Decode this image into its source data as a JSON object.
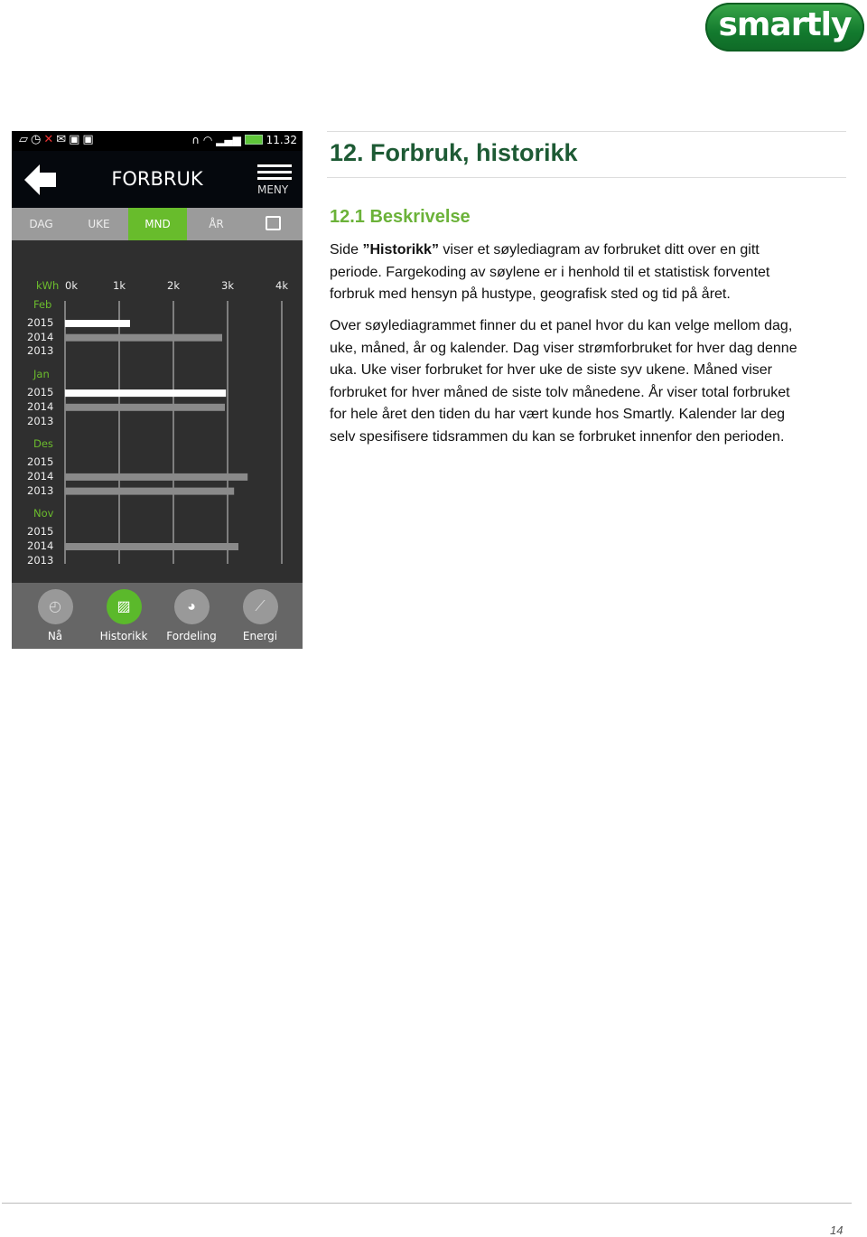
{
  "logo": {
    "text": "smartly"
  },
  "phone": {
    "status_bar": {
      "icons": [
        "screenshot-icon",
        "download-icon",
        "missed-call-icon",
        "mail-icon",
        "bag-icon",
        "clipboard-icon",
        "headset-icon",
        "wifi-icon",
        "signal-icon",
        "battery-icon"
      ],
      "time": "11.32"
    },
    "header": {
      "title": "FORBRUK",
      "menu_label": "MENY"
    },
    "tabs": [
      {
        "label": "DAG",
        "active": false
      },
      {
        "label": "UKE",
        "active": false
      },
      {
        "label": "MND",
        "active": true
      },
      {
        "label": "ÅR",
        "active": false
      }
    ],
    "nav": [
      {
        "label": "Nå",
        "icon": "stopwatch-icon",
        "active": false
      },
      {
        "label": "Historikk",
        "icon": "chart-icon",
        "active": true
      },
      {
        "label": "Fordeling",
        "icon": "pie-icon",
        "active": false
      },
      {
        "label": "Energi",
        "icon": "line-chart-icon",
        "active": false
      }
    ],
    "colors": {
      "accent": "#68bc2c",
      "current_year_bar": "#ffffff",
      "previous_year_bar": "#8a8a8a"
    }
  },
  "chart_data": {
    "type": "bar",
    "orientation": "horizontal",
    "unit_label": "kWh",
    "x_ticks": [
      "0k",
      "1k",
      "2k",
      "3k",
      "4k"
    ],
    "xlim": [
      0,
      4000
    ],
    "grid": true,
    "groups": [
      {
        "month": "Feb",
        "rows": [
          {
            "year": "2015",
            "value": 1200
          },
          {
            "year": "2014",
            "value": 2900
          },
          {
            "year": "2013",
            "value": null
          }
        ]
      },
      {
        "month": "Jan",
        "rows": [
          {
            "year": "2015",
            "value": 2970
          },
          {
            "year": "2014",
            "value": 2950
          },
          {
            "year": "2013",
            "value": null
          }
        ]
      },
      {
        "month": "Des",
        "rows": [
          {
            "year": "2015",
            "value": null
          },
          {
            "year": "2014",
            "value": 3370
          },
          {
            "year": "2013",
            "value": 3120
          }
        ]
      },
      {
        "month": "Nov",
        "rows": [
          {
            "year": "2015",
            "value": null
          },
          {
            "year": "2014",
            "value": 3200
          },
          {
            "year": "2013",
            "value": null
          }
        ]
      }
    ]
  },
  "doc": {
    "heading": "12.  Forbruk, historikk",
    "subheading": "12.1  Beskrivelse",
    "p1": {
      "pre": "Side ",
      "bold": "”Historikk”",
      "post": " viser et søylediagram av forbruket ditt over en gitt",
      "lines": [
        "periode. Fargekoding av søylene er i henhold til et statistisk forventet",
        "forbruk med hensyn på hustype, geografisk sted og tid på året."
      ]
    },
    "p2": {
      "lines": [
        "Over søylediagrammet finner du et panel hvor du kan velge mellom dag,",
        "uke, måned, år og kalender. Dag viser strømforbruket for hver dag denne",
        "uka.  Uke viser forbruket for hver uke de siste syv ukene. Måned viser",
        "forbruket for hver måned de siste tolv månedene. År viser total forbruket",
        "for hele året den tiden du har vært kunde hos Smartly. Kalender lar deg",
        "selv spesifisere tidsrammen du kan se forbruket innenfor den perioden."
      ]
    },
    "page_number": "14"
  }
}
